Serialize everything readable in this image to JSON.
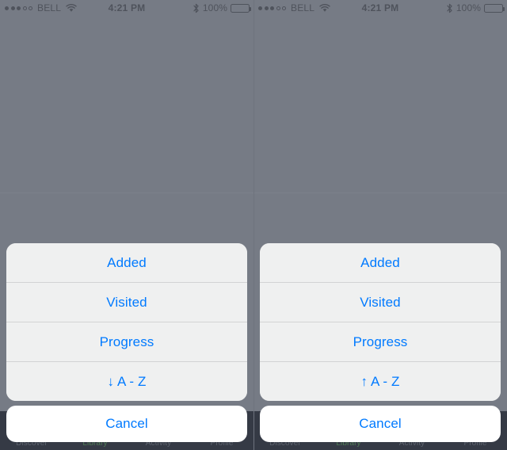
{
  "theme": {
    "tint_blue": "#007aff",
    "dim_overlay": "#767b85",
    "sheet_bg": "#eff0f0",
    "cancel_bg": "#ffffff",
    "tabbar_bg": "#353a45",
    "separator": "#d2d3d4",
    "active_tab": "#4f7a55"
  },
  "status_bar": {
    "signal_dots_filled": 3,
    "signal_dots_empty": 2,
    "carrier": "BELL",
    "wifi_icon": "wifi-icon",
    "time": "4:21 PM",
    "bluetooth_icon": "bluetooth-icon",
    "battery_percent": "100%",
    "battery_icon": "battery-full-icon"
  },
  "tab_bar": {
    "items": [
      {
        "label": "Discover",
        "active": false
      },
      {
        "label": "Library",
        "active": true
      },
      {
        "label": "Activity",
        "active": false
      },
      {
        "label": "Profile",
        "active": false
      }
    ]
  },
  "panels": [
    {
      "id": "panel-descending",
      "action_sheet": {
        "options": [
          {
            "label": "Added"
          },
          {
            "label": "Visited"
          },
          {
            "label": "Progress"
          },
          {
            "label": "↓ A - Z",
            "icon": "arrow-down-icon"
          }
        ],
        "cancel_label": "Cancel"
      }
    },
    {
      "id": "panel-ascending",
      "action_sheet": {
        "options": [
          {
            "label": "Added"
          },
          {
            "label": "Visited"
          },
          {
            "label": "Progress"
          },
          {
            "label": "↑ A - Z",
            "icon": "arrow-up-icon"
          }
        ],
        "cancel_label": "Cancel"
      }
    }
  ]
}
